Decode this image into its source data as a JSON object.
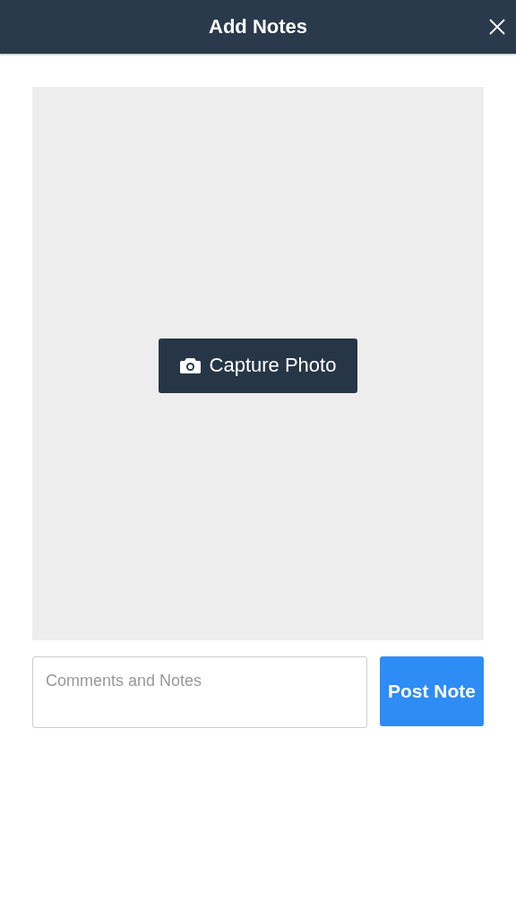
{
  "header": {
    "title": "Add Notes"
  },
  "photo_area": {
    "capture_button": "Capture Photo"
  },
  "notes_field": {
    "placeholder": "Comments and Notes"
  },
  "post_button": "Post Note"
}
